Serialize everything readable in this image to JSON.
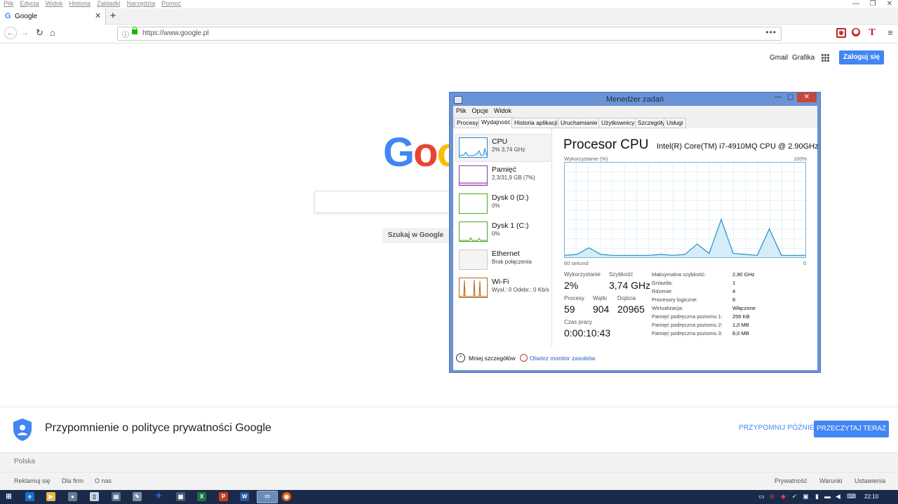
{
  "browser": {
    "menu": [
      "Plik",
      "Edycja",
      "Widok",
      "Historia",
      "Zakładki",
      "Narzędzia",
      "Pomoc"
    ],
    "tab_title": "Google",
    "url": "https://www.google.pl"
  },
  "google": {
    "links": [
      "Gmail",
      "Grafika"
    ],
    "signin": "Zaloguj się",
    "logo": "Goog",
    "search_button": "Szukaj w Google",
    "privacy_text": "Przypomnienie o polityce prywatności Google",
    "remind_later": "PRZYPOMNIJ PÓŹNIEJ",
    "read_now": "PRZECZYTAJ TERAZ",
    "country": "Polska",
    "footer_left": [
      "Reklamuj się",
      "Dla firm",
      "O nas"
    ],
    "footer_right": [
      "Prywatność",
      "Warunki",
      "Ustawienia"
    ]
  },
  "taskmgr": {
    "title": "Menedżer zadań",
    "menu": [
      "Plik",
      "Opcje",
      "Widok"
    ],
    "tabs": [
      "Procesy",
      "Wydajność",
      "Historia aplikacji",
      "Uruchamianie",
      "Użytkownicy",
      "Szczegóły",
      "Usługi"
    ],
    "active_tab": "Wydajność",
    "resources": [
      {
        "name": "CPU",
        "sub": "2%  3,74 GHz",
        "color": "#1f8ec9"
      },
      {
        "name": "Pamięć",
        "sub": "2,3/31,9 GB (7%)",
        "color": "#8b3aa8"
      },
      {
        "name": "Dysk 0 (D:)",
        "sub": "0%",
        "color": "#4da81f"
      },
      {
        "name": "Dysk 1 (C:)",
        "sub": "0%",
        "color": "#4da81f"
      },
      {
        "name": "Ethernet",
        "sub": "Brak połączenia",
        "color": "#c8c8c8"
      },
      {
        "name": "Wi-Fi",
        "sub": "Wysł.: 0 Odebr.: 0 Kb/s",
        "color": "#b8651c"
      }
    ],
    "detail": {
      "heading": "Procesor CPU",
      "model": "Intel(R) Core(TM) i7-4910MQ CPU @ 2.90GHz",
      "util_label": "Wykorzystanie (%)",
      "max_label": "100%",
      "time_label": "60 sekund",
      "zero_label": "0",
      "stats": {
        "util_label": "Wykorzystanie",
        "util": "2%",
        "speed_label": "Szybkość",
        "speed": "3,74 GHz",
        "proc_label": "Procesy",
        "proc": "59",
        "threads_label": "Wątki",
        "threads": "904",
        "handles_label": "Dojścia",
        "handles": "20965",
        "uptime_label": "Czas pracy",
        "uptime": "0:00:10:43"
      },
      "specs": [
        {
          "k": "Maksymalna szybkość:",
          "v": "2,90 GHz"
        },
        {
          "k": "Gniazda:",
          "v": "1"
        },
        {
          "k": "Rdzenie:",
          "v": "4"
        },
        {
          "k": "Procesory logiczne:",
          "v": "8"
        },
        {
          "k": "Wirtualizacja:",
          "v": "Włączone"
        },
        {
          "k": "Pamięć podręczna poziomu 1:",
          "v": "256 KB"
        },
        {
          "k": "Pamięć podręczna poziomu 2:",
          "v": "1,0 MB"
        },
        {
          "k": "Pamięć podręczna poziomu 3:",
          "v": "8,0 MB"
        }
      ]
    },
    "fewer_details": "Mniej szczegółów",
    "resmon": "Otwórz monitor zasobów"
  },
  "chart_data": {
    "type": "area",
    "x": [
      60,
      57,
      54,
      51,
      48,
      45,
      42,
      39,
      36,
      33,
      30,
      27,
      24,
      21,
      18,
      15,
      12,
      9,
      6,
      3,
      0
    ],
    "values": [
      2,
      3,
      10,
      3,
      2,
      2,
      2,
      2,
      3,
      2,
      3,
      14,
      4,
      40,
      4,
      3,
      2,
      30,
      2,
      2,
      2
    ],
    "xlim": [
      60,
      0
    ],
    "ylim": [
      0,
      100
    ]
  },
  "taskbar": {
    "clock": "22:10"
  }
}
